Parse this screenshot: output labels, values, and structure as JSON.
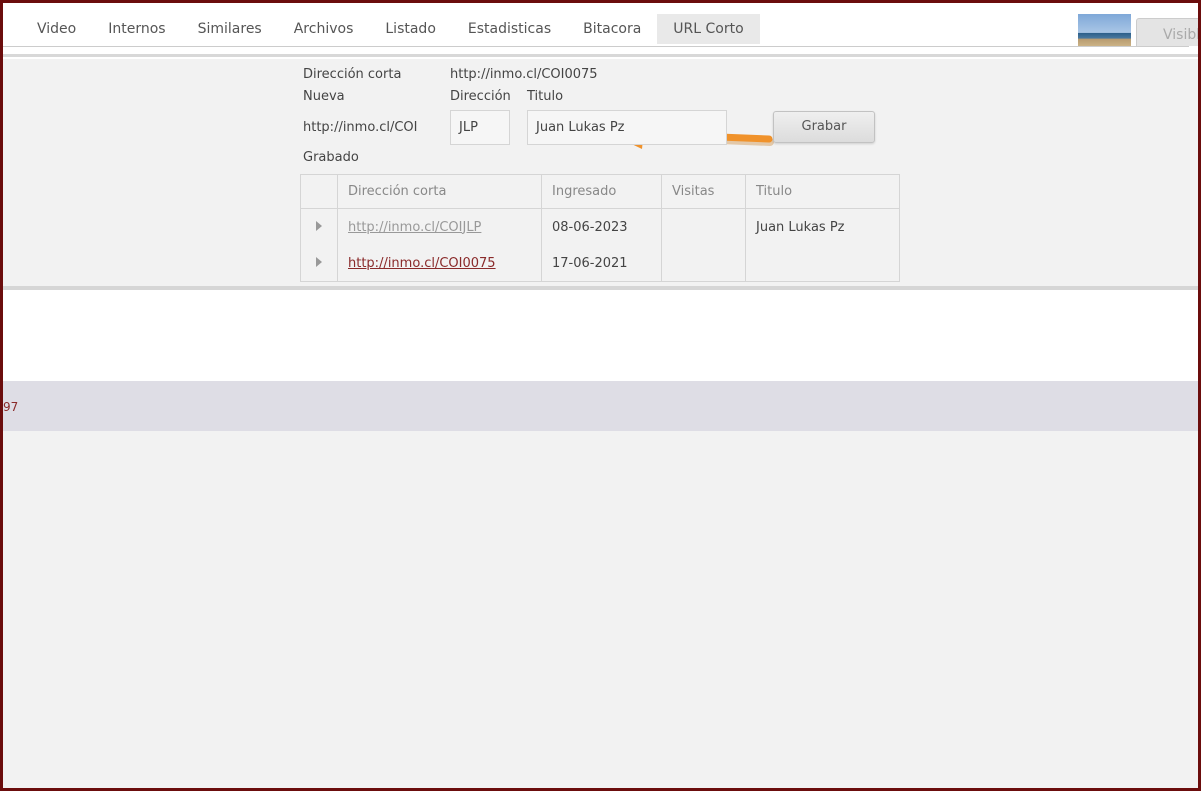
{
  "tabs": [
    {
      "label": "Video"
    },
    {
      "label": "Internos"
    },
    {
      "label": "Similares"
    },
    {
      "label": "Archivos"
    },
    {
      "label": "Listado"
    },
    {
      "label": "Estadisticas"
    },
    {
      "label": "Bitacora"
    },
    {
      "label": "URL Corto",
      "active": true
    }
  ],
  "header": {
    "visible_label": "Visible"
  },
  "form": {
    "short_label": "Dirección corta",
    "short_value": "http://inmo.cl/COI0075",
    "new_label": "Nueva",
    "direccion_label": "Dirección",
    "titulo_label": "Titulo",
    "prefix": "http://inmo.cl/COI",
    "direccion_value": "JLP",
    "titulo_value": "Juan Lukas Pz",
    "save_label": "Grabar",
    "saved_label": "Grabado"
  },
  "table": {
    "columns": [
      "",
      "Dirección corta",
      "Ingresado",
      "Visitas",
      "Titulo"
    ],
    "rows": [
      {
        "url": "http://inmo.cl/COIJLP",
        "ingresado": "08-06-2023",
        "visitas": "",
        "titulo": "Juan Lukas Pz"
      },
      {
        "url": "http://inmo.cl/COI0075",
        "ingresado": "17-06-2021",
        "visitas": "",
        "titulo": ""
      }
    ]
  },
  "footer": {
    "text": "97"
  },
  "colors": {
    "accent_arrow": "#f0922b",
    "frame": "#6b0d0d",
    "link_active": "#8a2a2a"
  }
}
